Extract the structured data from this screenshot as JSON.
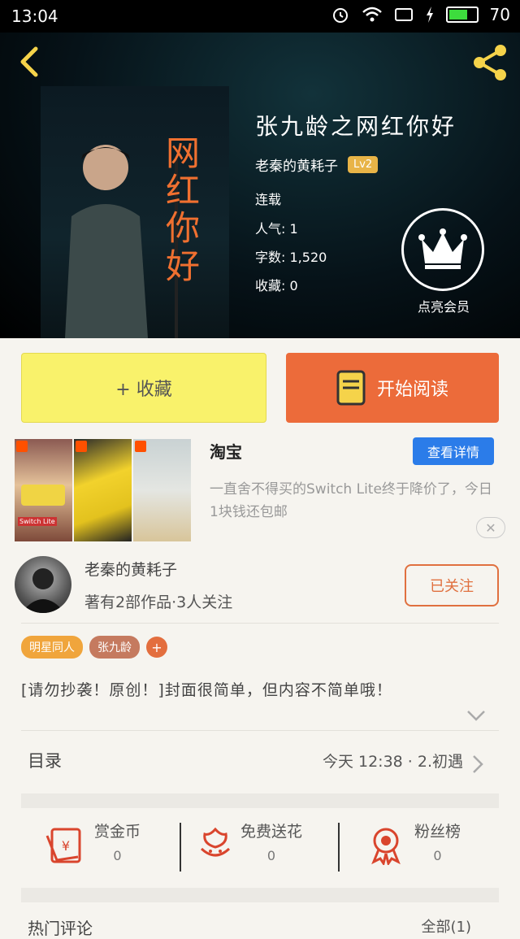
{
  "status": {
    "time": "13:04",
    "battery": "70",
    "battery_level": 0.7
  },
  "book": {
    "title": "张九龄之网红你好",
    "cover_text": [
      "网",
      "红",
      "你",
      "好"
    ],
    "author": "老秦的黄耗子",
    "level": "Lv2",
    "status": "连载",
    "popularity_label": "人气:",
    "popularity": "1",
    "words_label": "字数:",
    "words": "1,520",
    "favorites_label": "收藏:",
    "favorites": "0",
    "vip_label": "点亮会员"
  },
  "actions": {
    "favorite": "+ 收藏",
    "read": "开始阅读"
  },
  "ad": {
    "source": "淘宝",
    "detail_button": "查看详情",
    "description": "一直舍不得买的Switch Lite终于降价了，今日1块钱还包邮",
    "close": "✕",
    "thumb_captions": [
      "Switch Lite",
      "",
      ""
    ]
  },
  "author_card": {
    "name": "老秦的黄耗子",
    "summary": "著有2部作品·3人关注",
    "follow_label": "已关注"
  },
  "tags": [
    {
      "label": "明星同人",
      "color": "#f0a53c"
    },
    {
      "label": "张九龄",
      "color": "#c57a5f"
    }
  ],
  "tag_add": "+",
  "intro": "[请勿抄袭！原创！]封面很简单，但内容不简单哦！",
  "toc": {
    "label": "目录",
    "latest": "今天 12:38 · 2.初遇"
  },
  "stats": [
    {
      "label": "赏金币",
      "value": "0",
      "icon": "red-envelope-icon"
    },
    {
      "label": "免费送花",
      "value": "0",
      "icon": "flower-icon"
    },
    {
      "label": "粉丝榜",
      "value": "0",
      "icon": "award-ribbon-icon"
    }
  ],
  "comments": {
    "label": "热门评论",
    "right": "全部(1)"
  },
  "colors": {
    "accent": "#ec6b3a",
    "fav_button": "#f9f26b",
    "detail_blue": "#2b7ce9",
    "stat_red": "#d9452d"
  }
}
